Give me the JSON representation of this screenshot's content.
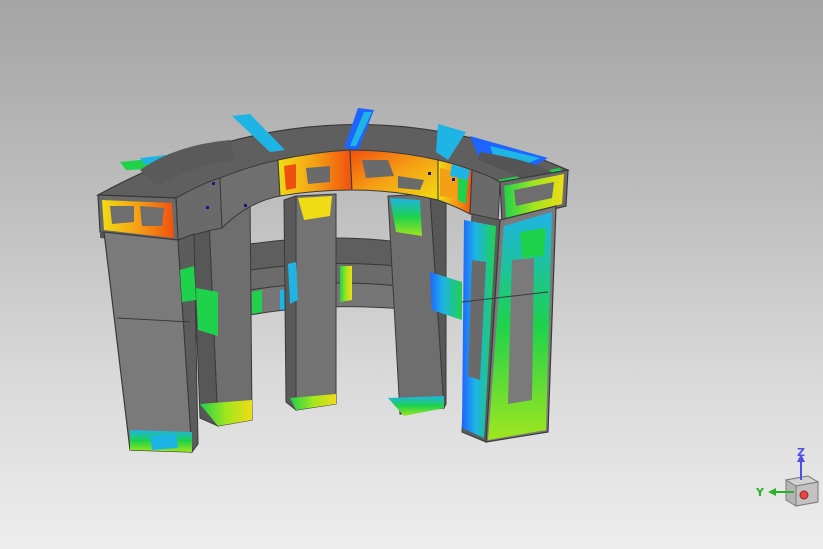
{
  "viewport": {
    "background_top": "#a4a4a4",
    "background_bottom": "#ededed"
  },
  "model": {
    "kind": "fea-contour-plot",
    "base_color": "#6f6f6f",
    "edge_color": "#3a3a3a",
    "contour_colors": [
      "#1e64ff",
      "#1eb4e6",
      "#1ed24b",
      "#a0e61e",
      "#f0dc14",
      "#f5a014",
      "#f0500f"
    ]
  },
  "triad": {
    "z_label": "Z",
    "y_label": "Y",
    "z_color": "#5050e6",
    "y_color": "#28b428",
    "x_color": "#e64646"
  }
}
